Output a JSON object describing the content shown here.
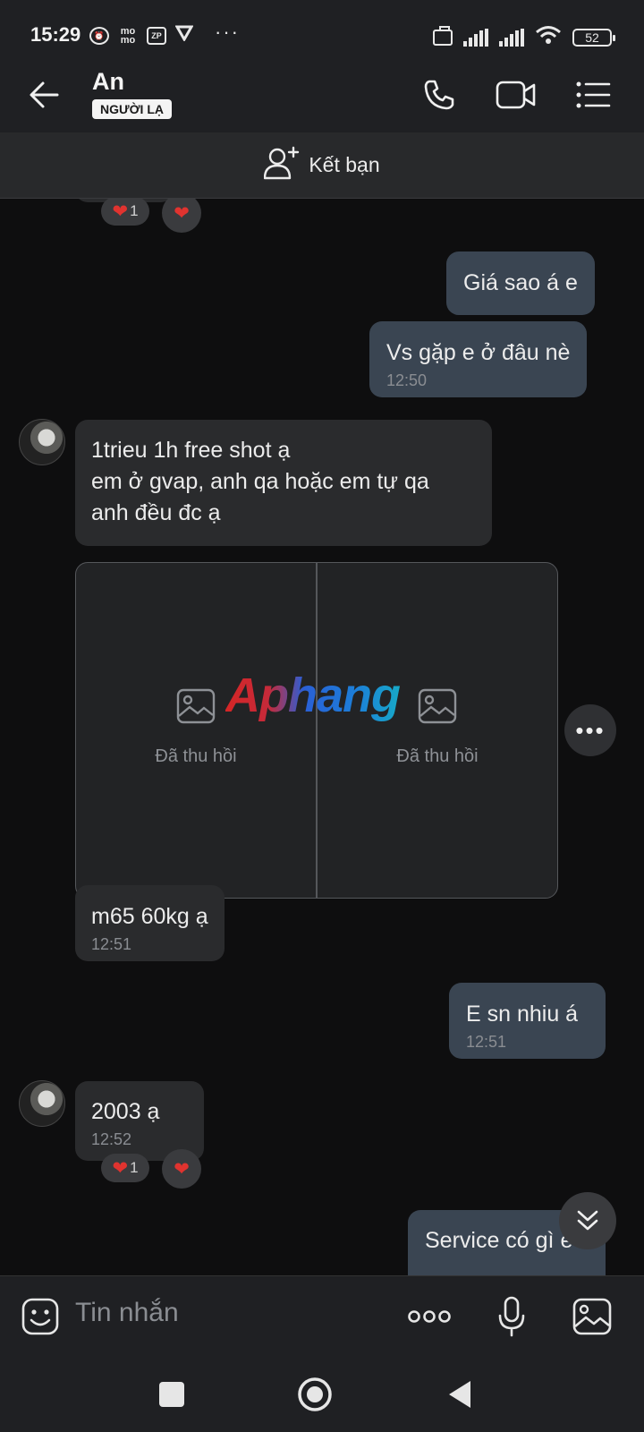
{
  "status": {
    "time": "15:29",
    "icons": [
      "alarm-icon",
      "momo-icon",
      "zalopay-icon",
      "vpn-icon"
    ],
    "more": "···",
    "battery": "52"
  },
  "header": {
    "contact_name": "An",
    "tag": "NGƯỜI LẠ"
  },
  "add_friend": {
    "label": "Kết bạn"
  },
  "messages": {
    "top_reaction_count": "1",
    "m1": {
      "text": "Giá sao á e"
    },
    "m2": {
      "text": "Vs gặp e ở đâu nè",
      "time": "12:50"
    },
    "m3": {
      "lines": [
        "1trieu 1h free shot ạ",
        "em ở gvap, anh qa hoặc em tự qa",
        "anh đều đc ạ"
      ]
    },
    "images": {
      "revoked_left": "Đã thu hồi",
      "revoked_right": "Đã thu hồi",
      "watermark": "Aphang"
    },
    "m4": {
      "text": "m65 60kg ạ",
      "time": "12:51"
    },
    "m5": {
      "text": "E sn nhiu á",
      "time": "12:51"
    },
    "m6": {
      "text": "2003 ạ",
      "time": "12:52",
      "reaction_count": "1"
    },
    "m7": {
      "text": "Service có gì e"
    }
  },
  "input": {
    "placeholder": "Tin nhắn"
  },
  "colors": {
    "outgoing_bubble": "#3a4552",
    "incoming_bubble": "#2a2b2d",
    "heart": "#e0332f"
  }
}
